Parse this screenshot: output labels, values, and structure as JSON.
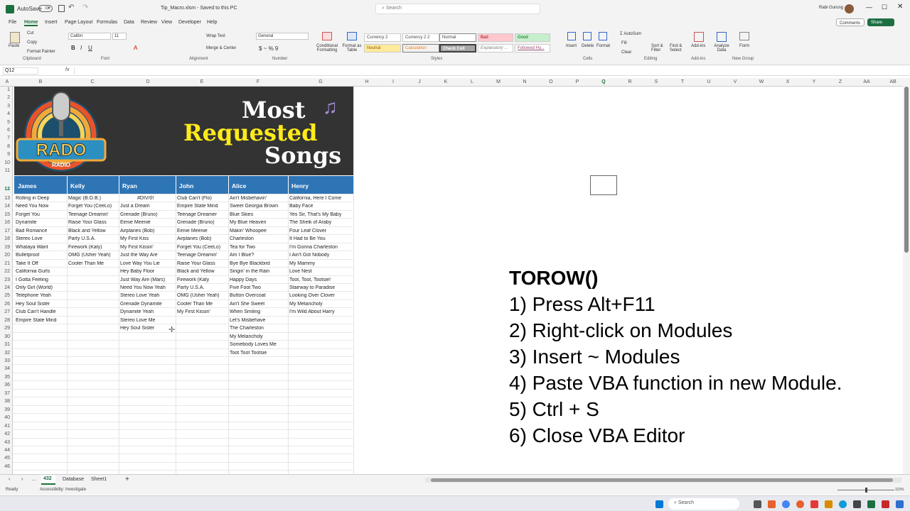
{
  "window": {
    "autosave_label": "AutoSave",
    "autosave_state": "Off",
    "filename": "Tip_Macro.xlsm - Saved to this PC",
    "search_placeholder": "Search",
    "user": "Rabi Gurung"
  },
  "menu": [
    "File",
    "Home",
    "Insert",
    "Page Layout",
    "Formulas",
    "Data",
    "Review",
    "View",
    "Developer",
    "Help"
  ],
  "menu_right": {
    "comments": "Comments",
    "share": "Share"
  },
  "ribbon": {
    "clipboard": {
      "paste": "Paste",
      "cut": "Cut",
      "copy": "Copy",
      "painter": "Format Painter",
      "label": "Clipboard"
    },
    "font": {
      "name": "Calibri",
      "size": "11",
      "label": "Font"
    },
    "alignment": {
      "wrap": "Wrap Text",
      "merge": "Merge & Center",
      "label": "Alignment"
    },
    "number": {
      "format": "General",
      "label": "Number"
    },
    "styles": {
      "cond": "Conditional Formatting",
      "table": "Format as Table",
      "label": "Styles",
      "cells": [
        [
          "Currency 2",
          "Currency 2 2",
          "Normal",
          "Bad",
          "Good"
        ],
        [
          "Neutral",
          "Calculation",
          "Check Cell",
          "Explanatory ...",
          "Followed Hy..."
        ]
      ]
    },
    "cells": {
      "insert": "Insert",
      "delete": "Delete",
      "format": "Format",
      "label": "Cells"
    },
    "editing": {
      "autosum": "AutoSum",
      "fill": "Fill",
      "clear": "Clear",
      "sort": "Sort & Filter",
      "find": "Find & Select",
      "label": "Editing"
    },
    "addins": {
      "addins": "Add-ins",
      "analyze": "Analyze Data",
      "label": "Add-ins"
    },
    "newgroup": {
      "form": "Form",
      "label": "New Group"
    }
  },
  "namebox": "Q12",
  "fx": "fx",
  "columns": [
    "A",
    "B",
    "C",
    "D",
    "E",
    "F",
    "G",
    "H",
    "I",
    "J",
    "K",
    "L",
    "M",
    "N",
    "O",
    "P",
    "Q",
    "R",
    "S",
    "T",
    "U",
    "V",
    "W",
    "X",
    "Y",
    "Z",
    "AA",
    "AB"
  ],
  "rows": [
    "1",
    "2",
    "3",
    "4",
    "5",
    "6",
    "7",
    "8",
    "9",
    "10",
    "11",
    "12",
    "13",
    "14",
    "15",
    "16",
    "17",
    "18",
    "19",
    "20",
    "21",
    "22",
    "23",
    "24",
    "25",
    "26",
    "27",
    "28",
    "29",
    "30",
    "31",
    "32",
    "33",
    "34",
    "35",
    "36",
    "37",
    "38",
    "39",
    "40",
    "41",
    "42",
    "43",
    "44",
    "45",
    "46"
  ],
  "banner": {
    "logo_text": "RADO",
    "logo_sub": "RADIO",
    "title1": "Most",
    "title2": "Requested",
    "title3": "Songs",
    "note_icon": "music-note-icon"
  },
  "table": {
    "headers": [
      "James",
      "Kelly",
      "Ryan",
      "John",
      "Alice",
      "Henry"
    ],
    "columns": [
      [
        "Rolling in Deep",
        "Need You Now",
        "Forget You",
        "Dynamite",
        "Bad Romance",
        "Stereo Love",
        "Whataya Want",
        "Bulletproof",
        "Take It Off",
        "California Gurls",
        "I Gotta Feeling",
        "Only Girl (World)",
        "Telephone Yeah",
        "Hey Soul Sister",
        "Club Can't Handle",
        "Empire State Mind"
      ],
      [
        "Magic (B.O.B.)",
        "Forget You (CeeLo)",
        "Teenage Dreamin'",
        "Raise Your Glass",
        "Black and Yellow",
        "Party U.S.A.",
        "Firework (Katy)",
        "OMG (Usher Yeah)",
        "Cooler Than Me"
      ],
      [
        "#DIV/0!",
        "Just a Dream",
        "Grenade (Bruno)",
        "Eenie Meenie",
        "Airplanes (Bob)",
        "My First Kiss",
        "My First Kissin'",
        "Just the Way Are",
        "Love Way You Lie",
        "Hey Baby Floor",
        "Just Way Are (Mars)",
        "Need You Now Yeah",
        "Stereo Love Yeah",
        "Grenade Dynamite",
        "Dynamite Yeah",
        "Stereo Love Me",
        "Hey Soul Sister"
      ],
      [
        "Club Can't (Flo)",
        "Empire State Mind",
        "Teenage Dreamer",
        "Grenade (Bruno)",
        "Eenie Meenie",
        "Airplanes (Bob)",
        "Forget You (CeeLo)",
        "Teenage Dreamin'",
        "Raise Your Glass",
        "Black and Yellow",
        "Firework (Katy",
        "Party U.S.A.",
        "OMG (Usher Yeah)",
        "Cooler Than Me",
        "My First Kissin'"
      ],
      [
        "Ain't Misbehavin'",
        "Sweet Georgia Brown",
        "Blue Skies",
        "My Blue Heaven",
        "Makin' Whoopee",
        "Charleston",
        "Tea for Two",
        "Am I Blue?",
        "Bye Bye Blackbird",
        "Singin' in the Rain",
        "Happy Days",
        "Five Foot Two",
        "Button Overcoat",
        "Ain't She Sweet",
        "When Smiling",
        "Let's Misbehave",
        "The Charleston",
        "My Melancholy",
        "Somebody Loves Me",
        "Toot Toot Tootsie"
      ],
      [
        "California, Here I Come",
        "Baby Face",
        "Yes Sir, That's My Baby",
        "The Sheik of Araby",
        "Four Leaf Clover",
        "It Had to Be You",
        "I'm Gonna Charleston",
        "I Ain't Got Nobody",
        "My Mammy",
        "Love Nest",
        "Toot, Toot, Tootsie!",
        "Stairway to Paradise",
        "Looking Over Clover",
        "My Melancholy",
        "I'm Wild About Harry"
      ]
    ]
  },
  "instructions": [
    "TOROW()",
    "1) Press Alt+F11",
    "2) Right-click on Modules",
    "3) Insert ~ Modules",
    "4) Paste VBA function in new Module.",
    "5) Ctrl + S",
    "6) Close VBA Editor"
  ],
  "sheets": [
    "432",
    "Database",
    "Sheet1"
  ],
  "status": {
    "ready": "Ready",
    "accessibility": "Accessibility: Investigate",
    "zoom": "115%"
  },
  "taskbar": {
    "search": "Search"
  }
}
